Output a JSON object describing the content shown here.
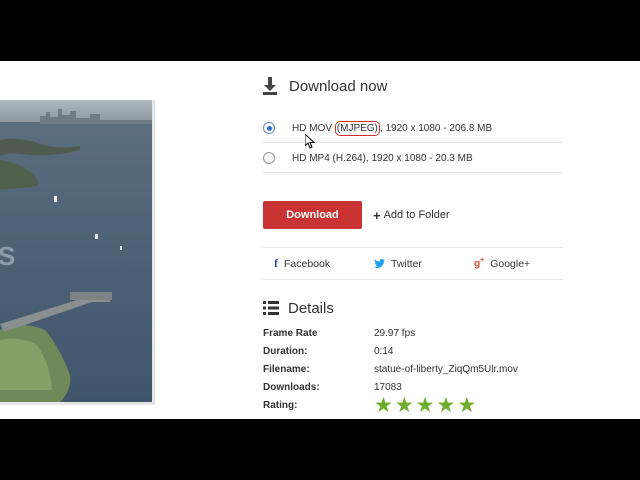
{
  "download": {
    "title": "Download now",
    "options": [
      {
        "selected": true,
        "before": "HD MOV ",
        "highlight": "(MJPEG)",
        "after": ", 1920 x 1080 - 206.8 MB"
      },
      {
        "selected": false,
        "before": "HD MP4 (H.264), 1920 x 1080 - 20.3 MB",
        "highlight": "",
        "after": ""
      }
    ],
    "button_label": "Download",
    "add_folder_label": "Add to Folder"
  },
  "share": {
    "facebook": "Facebook",
    "twitter": "Twitter",
    "googleplus": "Google+"
  },
  "details": {
    "title": "Details",
    "rows": [
      {
        "key": "Frame Rate",
        "value": "29.97 fps"
      },
      {
        "key": "Duration:",
        "value": "0:14"
      },
      {
        "key": "Filename:",
        "value": "statue-of-liberty_ZiqQm5Ulr.mov"
      },
      {
        "key": "Downloads:",
        "value": "17083"
      },
      {
        "key": "Rating:",
        "value": ""
      }
    ],
    "rating_stars": 5
  },
  "colors": {
    "accent_red": "#c93334",
    "star_green": "#6cad2b",
    "highlight_red": "#d1302b"
  }
}
